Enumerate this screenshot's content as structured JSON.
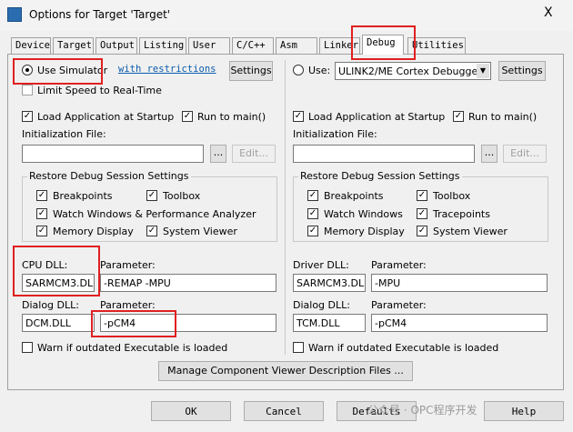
{
  "window": {
    "title": "Options for Target 'Target'",
    "close_label": "X"
  },
  "tabs": [
    "Device",
    "Target",
    "Output",
    "Listing",
    "User",
    "C/C++",
    "Asm",
    "Linker",
    "Debug",
    "Utilities"
  ],
  "active_tab": "Debug",
  "left": {
    "use_simulator_label": "Use Simulator",
    "with_restrictions_link": "with restrictions",
    "settings_label": "Settings",
    "limit_speed_label": "Limit Speed to Real-Time",
    "load_app_label": "Load Application at Startup",
    "run_to_main_label": "Run to main()",
    "init_file_label": "Initialization File:",
    "init_file_value": "",
    "browse_label": "...",
    "edit_label": "Edit...",
    "restore_group_title": "Restore Debug Session Settings",
    "breakpoints_label": "Breakpoints",
    "toolbox_label": "Toolbox",
    "watch_label": "Watch Windows & Performance Analyzer",
    "memory_label": "Memory Display",
    "system_viewer_label": "System Viewer",
    "cpu_dll_label": "CPU DLL:",
    "cpu_dll_value": "SARMCM3.DLL",
    "cpu_param_label": "Parameter:",
    "cpu_param_value": "-REMAP -MPU",
    "dialog_dll_label": "Dialog DLL:",
    "dialog_dll_value": "DCM.DLL",
    "dialog_param_label": "Parameter:",
    "dialog_param_value": "-pCM4",
    "warn_label": "Warn if outdated Executable is loaded"
  },
  "right": {
    "use_label": "Use:",
    "debugger_value": "ULINK2/ME Cortex Debugger",
    "settings_label": "Settings",
    "load_app_label": "Load Application at Startup",
    "run_to_main_label": "Run to main()",
    "init_file_label": "Initialization File:",
    "init_file_value": "",
    "browse_label": "...",
    "edit_label": "Edit...",
    "restore_group_title": "Restore Debug Session Settings",
    "breakpoints_label": "Breakpoints",
    "toolbox_label": "Toolbox",
    "watch_label": "Watch Windows",
    "tracepoints_label": "Tracepoints",
    "memory_label": "Memory Display",
    "system_viewer_label": "System Viewer",
    "driver_dll_label": "Driver DLL:",
    "driver_dll_value": "SARMCM3.DLL",
    "driver_param_label": "Parameter:",
    "driver_param_value": "-MPU",
    "dialog_dll_label": "Dialog DLL:",
    "dialog_dll_value": "TCM.DLL",
    "dialog_param_label": "Parameter:",
    "dialog_param_value": "-pCM4",
    "warn_label": "Warn if outdated Executable is loaded"
  },
  "manage_button_label": "Manage Component Viewer Description Files ...",
  "footer": {
    "ok_label": "OK",
    "cancel_label": "Cancel",
    "defaults_label": "Defaults",
    "help_label": "Help"
  },
  "watermark_text": "公众号 · OPC程序开发",
  "checkmark_glyph": "✓"
}
